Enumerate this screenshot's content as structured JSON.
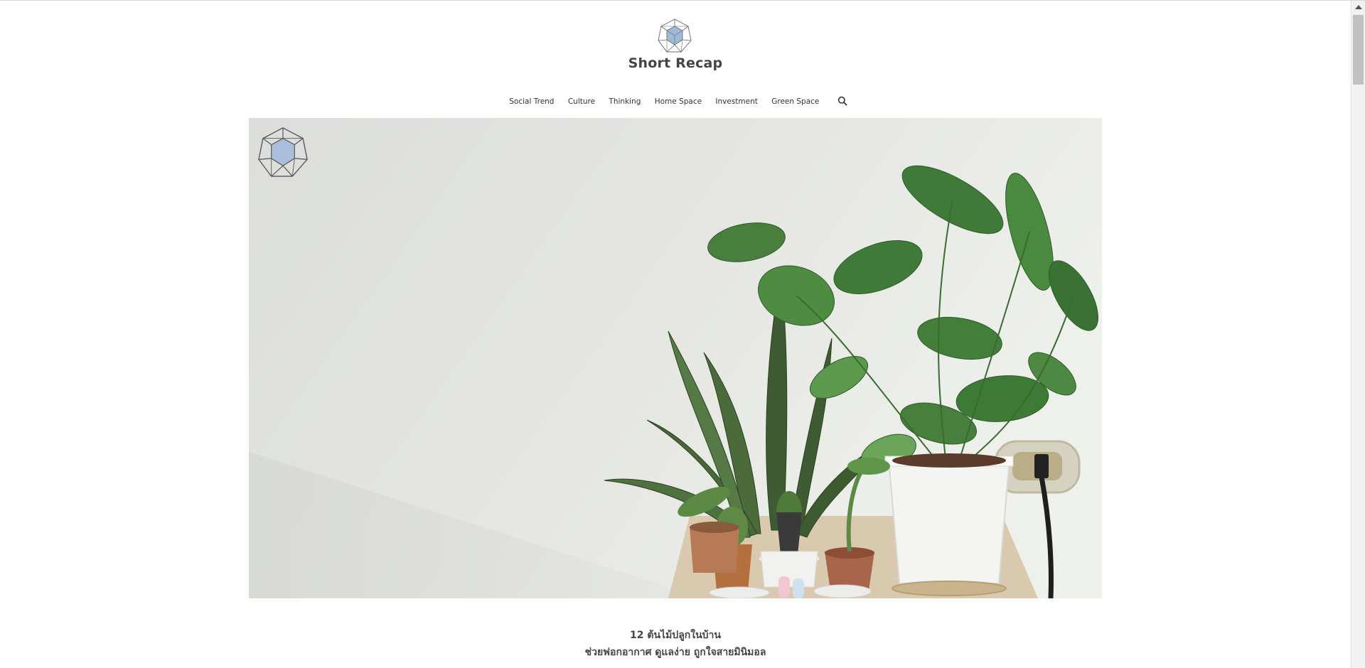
{
  "site": {
    "title": "Short Recap"
  },
  "nav": {
    "items": [
      {
        "label": "Social Trend"
      },
      {
        "label": "Culture"
      },
      {
        "label": "Thinking"
      },
      {
        "label": "Home Space"
      },
      {
        "label": "Investment"
      },
      {
        "label": "Green Space"
      }
    ],
    "search_icon": "search-icon"
  },
  "hero": {
    "image": "photo of houseplants in pots against a white wall",
    "watermark_icon": "geodesic-logo-icon"
  },
  "post": {
    "title_line1": "12 ต้นไม้ปลูกในบ้าน",
    "title_line2": "ช่วยฟอกอากาศ ดูแลง่าย ถูกใจสายมินิมอล"
  },
  "colors": {
    "logo_fill": "#9fb9d9",
    "logo_stroke": "#555555",
    "text": "#444444"
  }
}
